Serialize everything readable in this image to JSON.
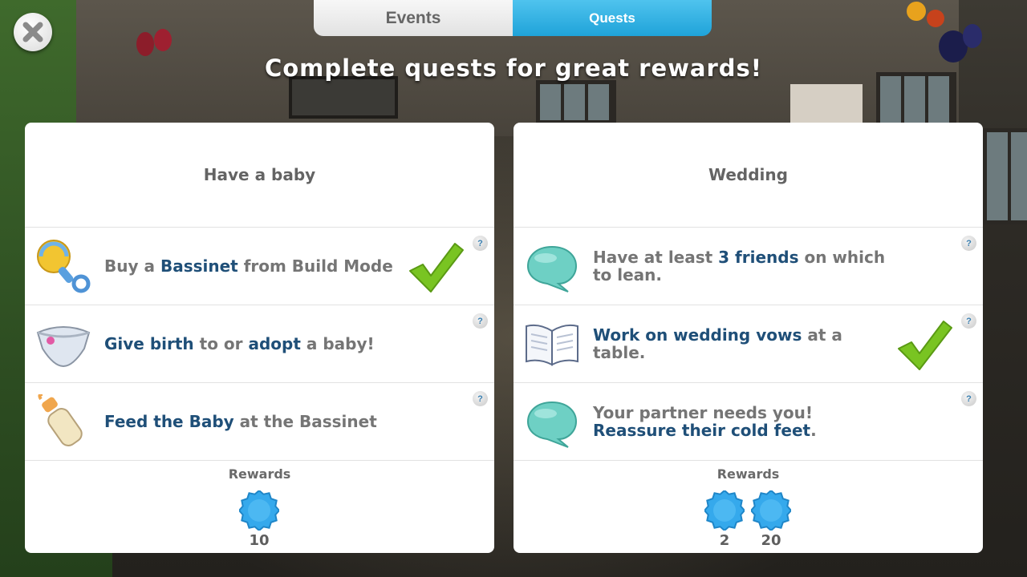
{
  "tabs": {
    "events": "Events",
    "quests": "Quests",
    "active": "quests"
  },
  "headline": "Complete quests for great rewards!",
  "colors": {
    "accent": "#1fa3d9",
    "highlight_text": "#1f4f78",
    "body_text": "#757575",
    "reward_badge": "#3bb0ef",
    "check": "#7cc220"
  },
  "quest_cards": [
    {
      "title": "Have a baby",
      "tasks": [
        {
          "icon": "baby-rattle-icon",
          "segments": [
            {
              "t": "Buy a ",
              "hl": false
            },
            {
              "t": "Bassinet",
              "hl": true
            },
            {
              "t": " from Build Mode",
              "hl": false
            }
          ],
          "completed": true,
          "help": "?"
        },
        {
          "icon": "diaper-icon",
          "segments": [
            {
              "t": "Give birth",
              "hl": true
            },
            {
              "t": " to or ",
              "hl": false
            },
            {
              "t": "adopt",
              "hl": true
            },
            {
              "t": " a baby!",
              "hl": false
            }
          ],
          "completed": false,
          "help": "?"
        },
        {
          "icon": "baby-bottle-icon",
          "segments": [
            {
              "t": "Feed the Baby",
              "hl": true
            },
            {
              "t": " at the Bassinet",
              "hl": false
            }
          ],
          "completed": false,
          "help": "?"
        }
      ],
      "rewards_label": "Rewards",
      "rewards": [
        {
          "icon": "simoleon-badge-icon",
          "count": "10"
        }
      ]
    },
    {
      "title": "Wedding",
      "tasks": [
        {
          "icon": "speech-bubble-icon",
          "segments": [
            {
              "t": "Have at least ",
              "hl": false
            },
            {
              "t": "3 friends",
              "hl": true
            },
            {
              "t": " on which to lean.",
              "hl": false
            }
          ],
          "completed": false,
          "help": "?"
        },
        {
          "icon": "open-book-icon",
          "segments": [
            {
              "t": "Work on wedding vows",
              "hl": true
            },
            {
              "t": " at a table.",
              "hl": false
            }
          ],
          "completed": true,
          "help": "?"
        },
        {
          "icon": "speech-bubble-icon",
          "segments": [
            {
              "t": "Your partner needs you! ",
              "hl": false
            },
            {
              "t": "Reassure their cold feet",
              "hl": true
            },
            {
              "t": ".",
              "hl": false
            }
          ],
          "completed": false,
          "help": "?"
        }
      ],
      "rewards_label": "Rewards",
      "rewards": [
        {
          "icon": "simoleon-badge-icon",
          "count": "2"
        },
        {
          "icon": "simoleon-badge-icon",
          "count": "20"
        }
      ]
    }
  ]
}
